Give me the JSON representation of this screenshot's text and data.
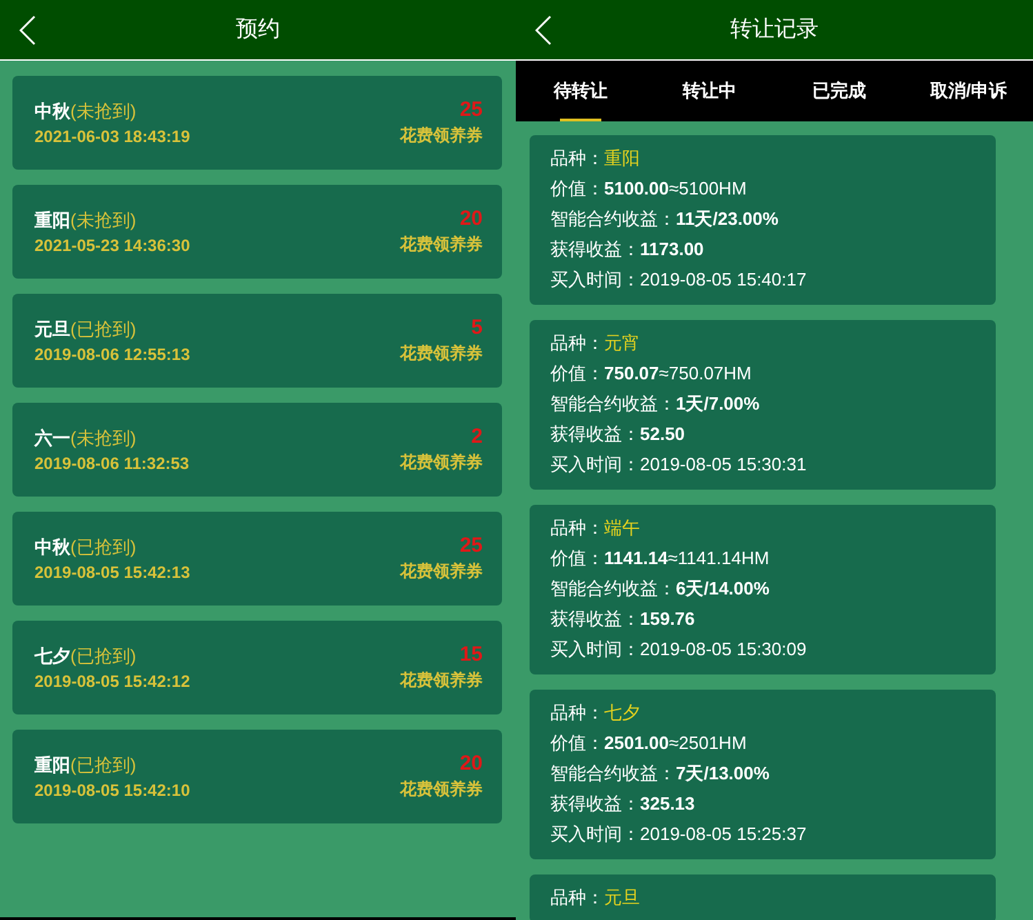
{
  "reservation": {
    "title": "预约",
    "items": [
      {
        "name": "中秋",
        "status": "(未抢到)",
        "time": "2021-06-03 18:43:19",
        "amount": "25",
        "unit": "花费领养券"
      },
      {
        "name": "重阳",
        "status": "(未抢到)",
        "time": "2021-05-23 14:36:30",
        "amount": "20",
        "unit": "花费领养券"
      },
      {
        "name": "元旦",
        "status": "(已抢到)",
        "time": "2019-08-06 12:55:13",
        "amount": "5",
        "unit": "花费领养券"
      },
      {
        "name": "六一",
        "status": "(未抢到)",
        "time": "2019-08-06 11:32:53",
        "amount": "2",
        "unit": "花费领养券"
      },
      {
        "name": "中秋",
        "status": "(已抢到)",
        "time": "2019-08-05 15:42:13",
        "amount": "25",
        "unit": "花费领养券"
      },
      {
        "name": "七夕",
        "status": "(已抢到)",
        "time": "2019-08-05 15:42:12",
        "amount": "15",
        "unit": "花费领养券"
      },
      {
        "name": "重阳",
        "status": "(已抢到)",
        "time": "2019-08-05 15:42:10",
        "amount": "20",
        "unit": "花费领养券"
      }
    ]
  },
  "transfer": {
    "title": "转让记录",
    "tabs": [
      {
        "label": "待转让",
        "selected": true
      },
      {
        "label": "转让中",
        "selected": false
      },
      {
        "label": "已完成",
        "selected": false
      },
      {
        "label": "取消/申诉",
        "selected": false
      }
    ],
    "records": [
      {
        "lines": [
          {
            "kind": "variety",
            "label": "品种：",
            "value": "重阳"
          },
          {
            "kind": "rich",
            "label": "价值：",
            "value": "**5100.00**≈5100HM"
          },
          {
            "kind": "rich",
            "label": "智能合约收益：",
            "value": "**11天/23.00%**"
          },
          {
            "kind": "rich",
            "label": "获得收益：",
            "value": "**1173.00**"
          },
          {
            "kind": "rich",
            "label": "买入时间：",
            "value": "2019-08-05 15:40:17"
          }
        ]
      },
      {
        "lines": [
          {
            "kind": "variety",
            "label": "品种：",
            "value": "元宵"
          },
          {
            "kind": "rich",
            "label": "价值：",
            "value": "**750.07**≈750.07HM"
          },
          {
            "kind": "rich",
            "label": "智能合约收益：",
            "value": "**1天/7.00%**"
          },
          {
            "kind": "rich",
            "label": "获得收益：",
            "value": "**52.50**"
          },
          {
            "kind": "rich",
            "label": "买入时间：",
            "value": "2019-08-05 15:30:31"
          }
        ]
      },
      {
        "lines": [
          {
            "kind": "variety",
            "label": "品种：",
            "value": "端午"
          },
          {
            "kind": "rich",
            "label": "价值：",
            "value": "**1141.14**≈1141.14HM"
          },
          {
            "kind": "rich",
            "label": "智能合约收益：",
            "value": "**6天/14.00%**"
          },
          {
            "kind": "rich",
            "label": "获得收益：",
            "value": "**159.76**"
          },
          {
            "kind": "rich",
            "label": "买入时间：",
            "value": "2019-08-05 15:30:09"
          }
        ]
      },
      {
        "lines": [
          {
            "kind": "variety",
            "label": "品种：",
            "value": "七夕"
          },
          {
            "kind": "rich",
            "label": "价值：",
            "value": "**2501.00**≈2501HM"
          },
          {
            "kind": "rich",
            "label": "智能合约收益：",
            "value": "**7天/13.00%**"
          },
          {
            "kind": "rich",
            "label": "获得收益：",
            "value": "**325.13**"
          },
          {
            "kind": "rich",
            "label": "买入时间：",
            "value": "2019-08-05 15:25:37"
          }
        ]
      },
      {
        "lines": [
          {
            "kind": "variety",
            "label": "品种：",
            "value": "元旦"
          }
        ]
      }
    ]
  }
}
